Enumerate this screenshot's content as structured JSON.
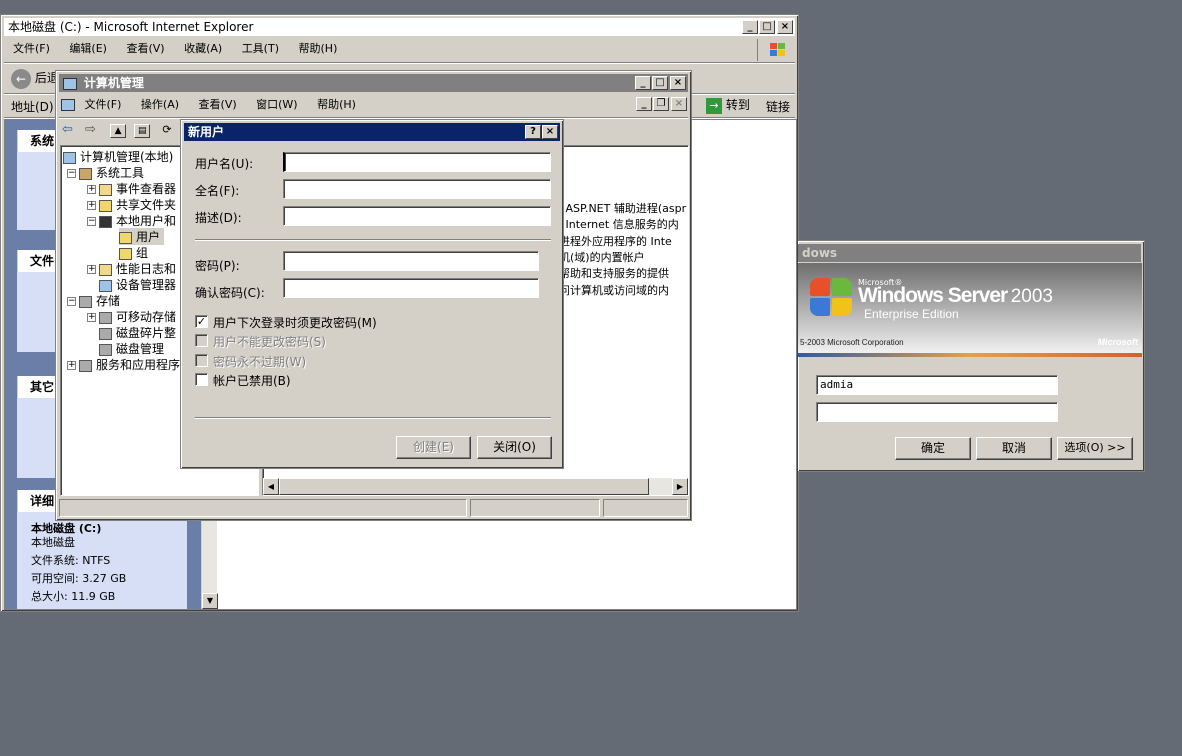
{
  "ie": {
    "title": "本地磁盘 (C:) - Microsoft Internet Explorer",
    "menu": [
      "文件(F)",
      "编辑(E)",
      "查看(V)",
      "收藏(A)",
      "工具(T)",
      "帮助(H)"
    ],
    "back_label": "后退",
    "address_label": "地址(D)",
    "go_label": "转到",
    "links_label": "链接",
    "sidebar": {
      "section1": "系统",
      "section2": "文件",
      "section3": "其它",
      "section4": "详细",
      "details": {
        "name": "本地磁盘 (C:)",
        "type": "本地磁盘",
        "fs": "文件系统: NTFS",
        "free": "可用空间: 3.27 GB",
        "total": "总大小: 11.9 GB"
      }
    }
  },
  "cm": {
    "title": "计算机管理",
    "menu": [
      "文件(F)",
      "操作(A)",
      "查看(V)",
      "窗口(W)",
      "帮助(H)"
    ],
    "tree": {
      "root": "计算机管理(本地)",
      "system_tools": "系统工具",
      "event_viewer": "事件查看器",
      "shared_folders": "共享文件夹",
      "local_users": "本地用户和",
      "users": "用户",
      "groups": "组",
      "perf_logs": "性能日志和",
      "device_manager": "设备管理器",
      "storage": "存储",
      "removable": "可移动存储",
      "defrag": "磁盘碎片整",
      "disk_mgmt": "磁盘管理",
      "services": "服务和应用程序"
    },
    "right_lines": [
      "' ASP.NET 辅助进程(aspr",
      "' Internet 信息服务的内",
      "进程外应用程序的 Inte",
      "机(域)的内置帐户",
      "帮助和支持服务的提供",
      "问计算机或访问域的内"
    ]
  },
  "dialog": {
    "title": "新用户",
    "help_btn": "?",
    "username_label": "用户名(U):",
    "fullname_label": "全名(F):",
    "desc_label": "描述(D):",
    "password_label": "密码(P):",
    "confirm_label": "确认密码(C):",
    "username_value": "",
    "fullname_value": "",
    "desc_value": "",
    "password_value": "",
    "confirm_value": "",
    "cb_must_change": "用户下次登录时须更改密码(M)",
    "cb_cannot_change": "用户不能更改密码(S)",
    "cb_never_expires": "密码永不过期(W)",
    "cb_disabled": "帐户已禁用(B)",
    "must_change_checked": "✓",
    "create_btn": "创建(E)",
    "close_btn": "关闭(O)"
  },
  "login": {
    "title": "dows",
    "brand_microsoft": "Microsoft®",
    "brand_windows": "Windows Server",
    "brand_year": "2003",
    "brand_edition": "Enterprise Edition",
    "copyright": "5-2003  Microsoft Corporation",
    "ms_logo": "Microsoft",
    "username_value": "admia",
    "password_value": "",
    "ok_btn": "确定",
    "cancel_btn": "取消",
    "options_btn": "选项(O) >>"
  },
  "colors": {
    "desktop": "#656b75",
    "titlebar_active": "#0a246a",
    "face": "#d4d0c8"
  }
}
